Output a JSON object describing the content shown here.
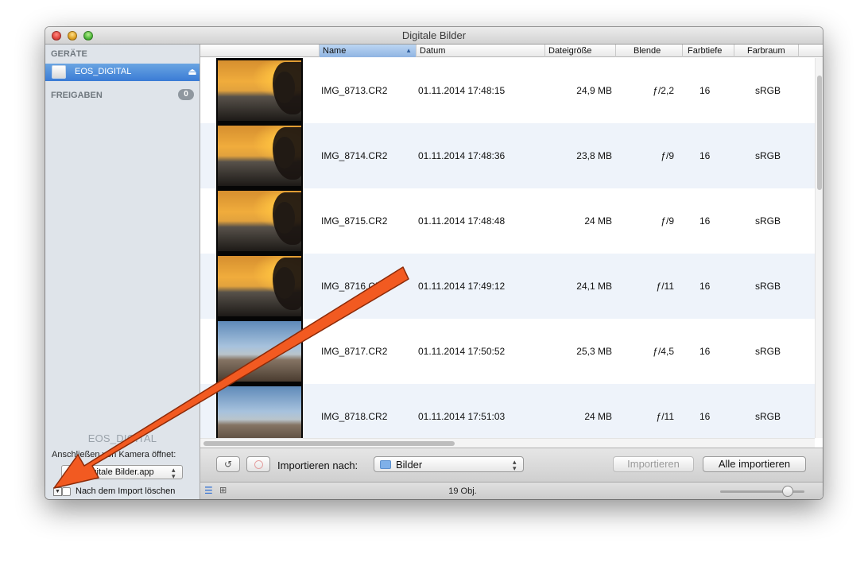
{
  "window": {
    "title": "Digitale Bilder"
  },
  "sidebar": {
    "devices_heading": "GERÄTE",
    "device_label": "EOS_DIGITAL",
    "eject_glyph": "⏏",
    "shares_heading": "FREIGABEN",
    "shares_count": "0",
    "panel": {
      "device_name": "EOS_DIGITAL",
      "connect_label": "Anschließen von Kamera öffnet:",
      "app_value": "Digitale Bilder.app",
      "delete_after_import_label": "Nach dem Import löschen",
      "delete_after_import_checked": false
    }
  },
  "columns": [
    "Name",
    "Datum",
    "Dateigröße",
    "Blende",
    "Farbtiefe",
    "Farbraum"
  ],
  "rows": [
    {
      "thumb": "sunset",
      "name": "IMG_8713.CR2",
      "date": "01.11.2014 17:48:15",
      "size": "24,9 MB",
      "aperture": "ƒ/2,2",
      "depth": "16",
      "space": "sRGB"
    },
    {
      "thumb": "sunset",
      "name": "IMG_8714.CR2",
      "date": "01.11.2014 17:48:36",
      "size": "23,8 MB",
      "aperture": "ƒ/9",
      "depth": "16",
      "space": "sRGB"
    },
    {
      "thumb": "sunset",
      "name": "IMG_8715.CR2",
      "date": "01.11.2014 17:48:48",
      "size": "24 MB",
      "aperture": "ƒ/9",
      "depth": "16",
      "space": "sRGB"
    },
    {
      "thumb": "sunset",
      "name": "IMG_8716.CR2",
      "date": "01.11.2014 17:49:12",
      "size": "24,1 MB",
      "aperture": "ƒ/11",
      "depth": "16",
      "space": "sRGB"
    },
    {
      "thumb": "day",
      "name": "IMG_8717.CR2",
      "date": "01.11.2014 17:50:52",
      "size": "25,3 MB",
      "aperture": "ƒ/4,5",
      "depth": "16",
      "space": "sRGB"
    },
    {
      "thumb": "day",
      "name": "IMG_8718.CR2",
      "date": "01.11.2014 17:51:03",
      "size": "24 MB",
      "aperture": "ƒ/11",
      "depth": "16",
      "space": "sRGB"
    }
  ],
  "toolbar": {
    "rotate_glyph": "↺",
    "import_to_label": "Importieren nach:",
    "folder_value": "Bilder",
    "import_label": "Importieren",
    "import_all_label": "Alle importieren"
  },
  "statusbar": {
    "count": "19 Obj."
  },
  "colors": {
    "accent": "#3a7bd5",
    "row_alt": "#eef3fa",
    "annotation_arrow": "#f25a21"
  }
}
